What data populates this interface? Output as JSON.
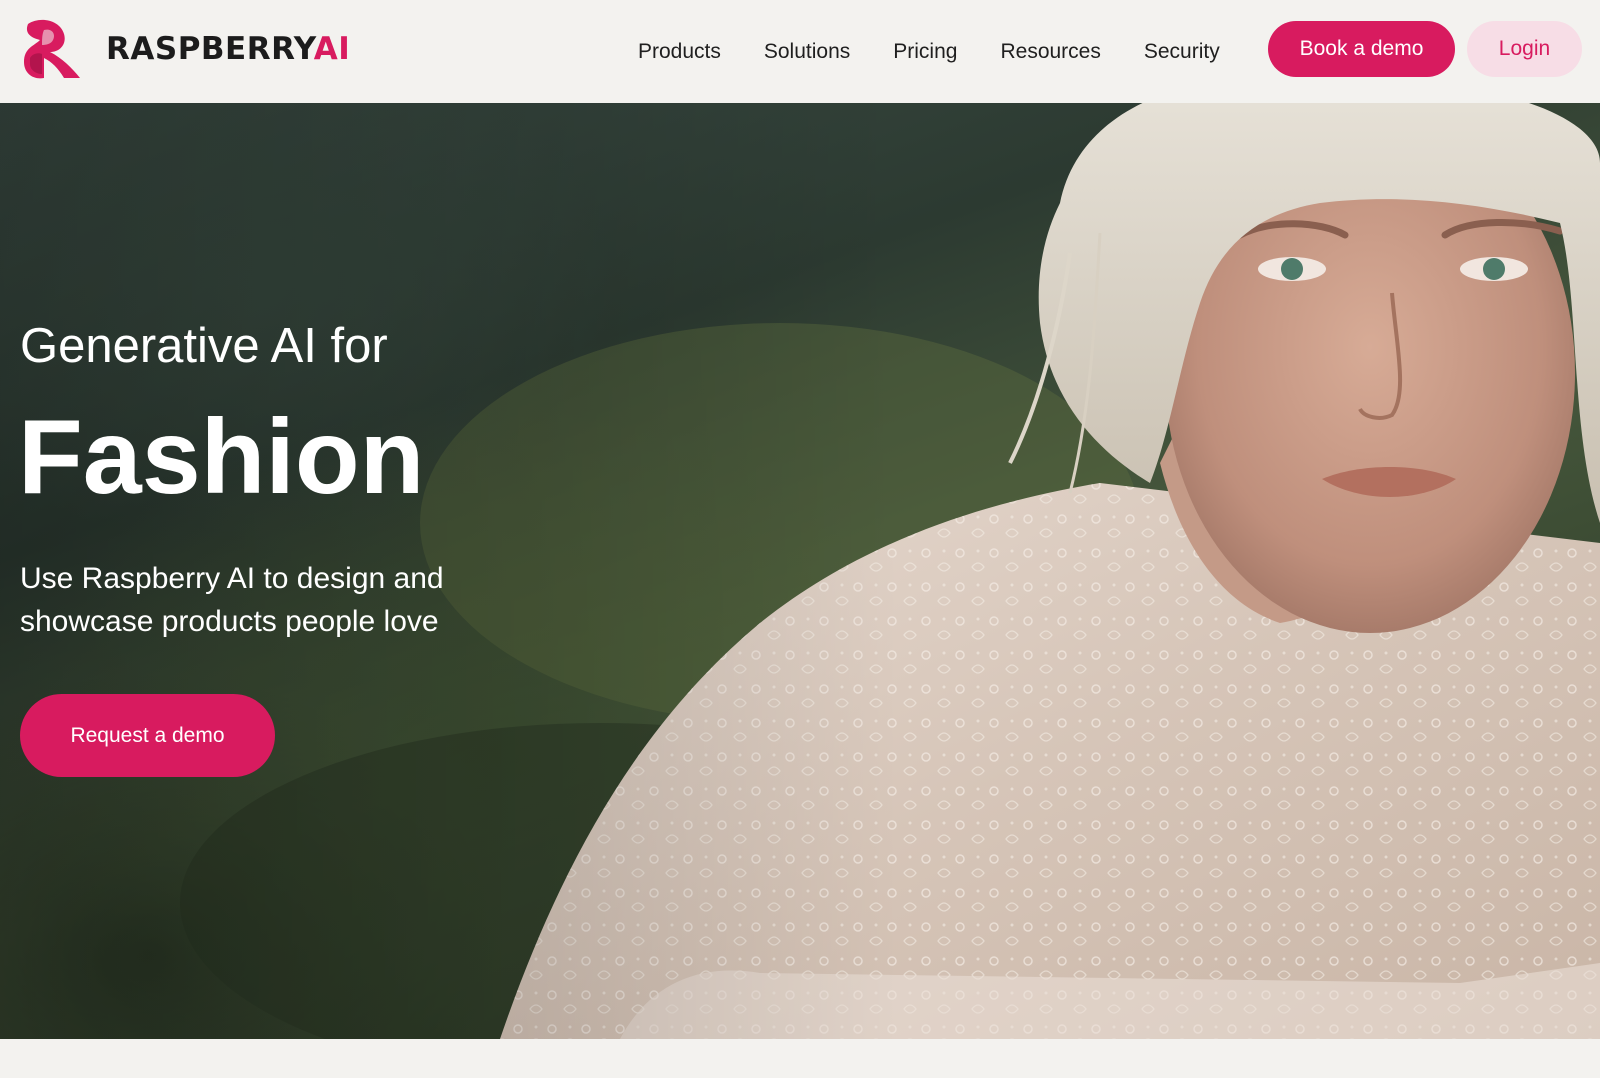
{
  "brand": {
    "name_main": "RASPBERRY",
    "name_accent": "AI",
    "logo_icon": "raspberry-r-logo",
    "accent_color": "#d81b5f",
    "accent_soft": "#f7dde6"
  },
  "nav": {
    "items": [
      {
        "label": "Products"
      },
      {
        "label": "Solutions"
      },
      {
        "label": "Pricing"
      },
      {
        "label": "Resources"
      },
      {
        "label": "Security"
      }
    ],
    "book_demo_label": "Book a demo",
    "login_label": "Login"
  },
  "hero": {
    "kicker": "Generative AI for",
    "title": "Fashion",
    "subtitle": "Use Raspberry AI to design and showcase products people love",
    "cta_label": "Request a demo",
    "image": "blonde model in white lace blouse against blurred green hillside"
  }
}
